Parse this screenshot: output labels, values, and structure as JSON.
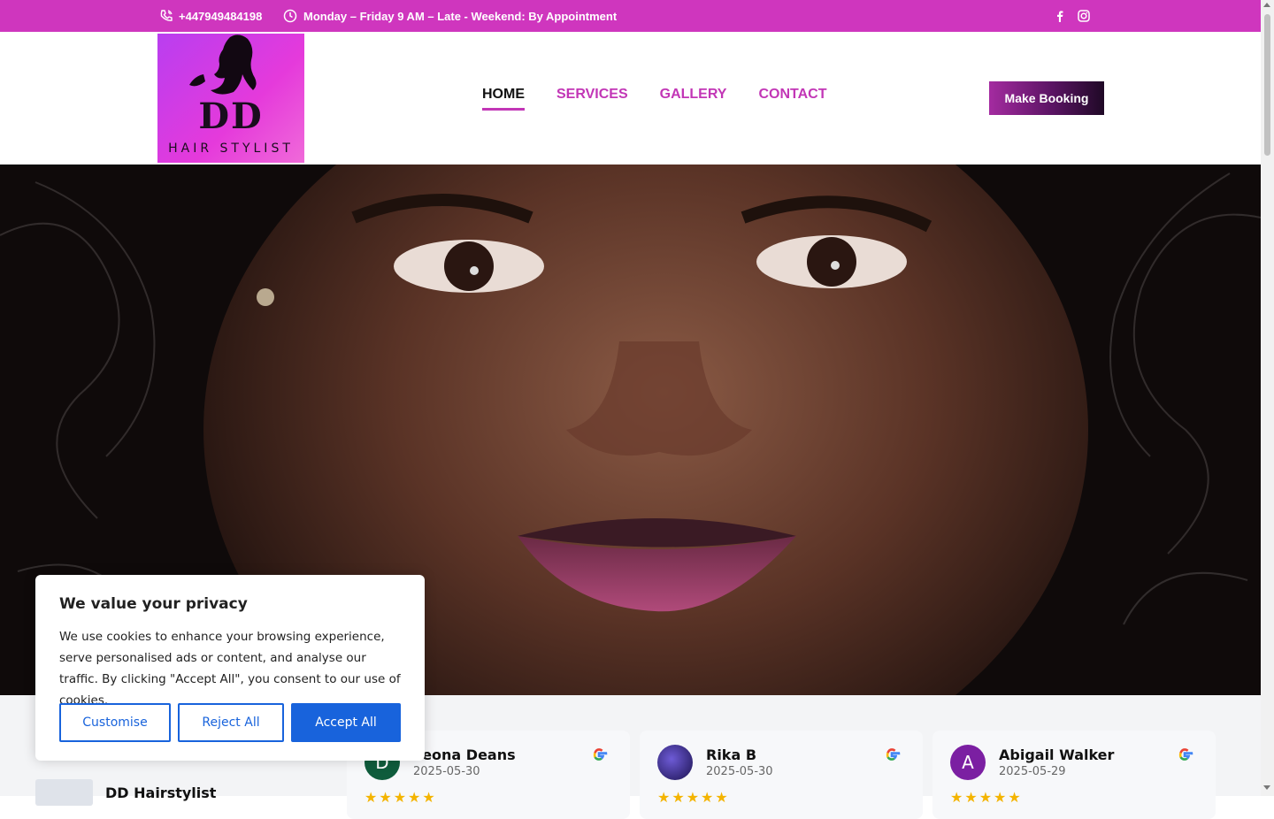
{
  "topbar": {
    "phone": "+447949484198",
    "hours": "Monday – Friday 9 AM – Late - Weekend: By Appointment",
    "social_icons": [
      "facebook-icon",
      "instagram-icon"
    ]
  },
  "header": {
    "logo": {
      "line1": "DD",
      "line2": "HAIR STYLIST"
    },
    "nav": [
      "HOME",
      "SERVICES",
      "GALLERY",
      "CONTACT"
    ],
    "active_nav": "HOME",
    "cta_label": "Make Booking"
  },
  "colors": {
    "brand_magenta": "#cf36be",
    "nav_link": "#c236b6",
    "cookie_blue": "#1863dc",
    "star_gold": "#f4b400"
  },
  "reviews": {
    "business_name": "DD Hairstylist",
    "items": [
      {
        "name": "Leona Deans",
        "date": "2025-05-30",
        "avatar_letter": "D",
        "avatar_color": "#0f5c3c",
        "rating": 5
      },
      {
        "name": "Rika B",
        "date": "2025-05-30",
        "avatar_letter": "",
        "avatar_color": "#2a1a5e",
        "rating": 5
      },
      {
        "name": "Abigail Walker",
        "date": "2025-05-29",
        "avatar_letter": "A",
        "avatar_color": "#7b1fa2",
        "rating": 5
      }
    ]
  },
  "cookie": {
    "title": "We value your privacy",
    "body": "We use cookies to enhance your browsing experience, serve personalised ads or content, and analyse our traffic. By clicking \"Accept All\", you consent to our use of cookies.",
    "customise_label": "Customise",
    "reject_label": "Reject All",
    "accept_label": "Accept All"
  }
}
